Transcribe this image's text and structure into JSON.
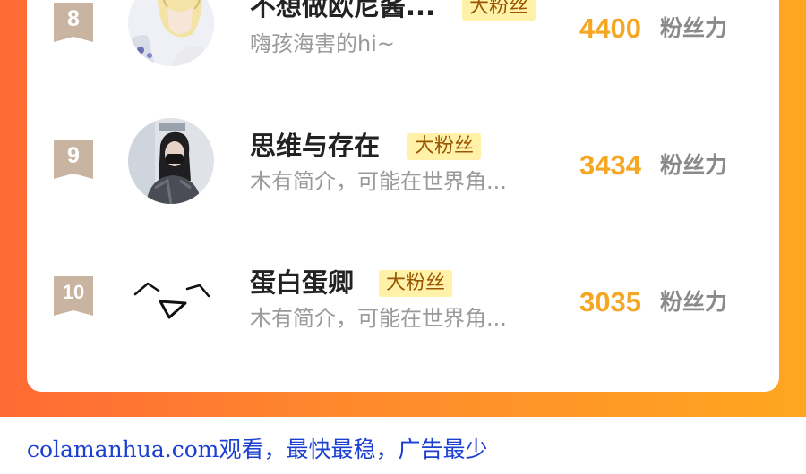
{
  "ranking": {
    "unit_label": "粉丝力",
    "rows": [
      {
        "rank": "8",
        "name": "不想做欧尼酱...",
        "tag": "大粉丝",
        "bio": "嗨孩海害的hi~",
        "score": "4400",
        "avatar_icon": "anime-blonde-character-avatar"
      },
      {
        "rank": "9",
        "name": "思维与存在",
        "tag": "大粉丝",
        "bio": "木有简介，可能在世界角...",
        "score": "3434",
        "avatar_icon": "masked-person-photo-avatar"
      },
      {
        "rank": "10",
        "name": "蛋白蛋卿",
        "tag": "大粉丝",
        "bio": "木有简介，可能在世界角...",
        "score": "3035",
        "avatar_icon": "doodle-face-avatar"
      }
    ]
  },
  "footer": {
    "text": "colamanhua.com观看，最快最稳，广告最少"
  },
  "colors": {
    "background_gradient_start": "#ff6a35",
    "background_gradient_end": "#ffa620",
    "score": "#f5a623",
    "tag_background": "#fff1a8",
    "rank_badge": "#c9b3a1",
    "footer_text": "#1a3fd1"
  }
}
